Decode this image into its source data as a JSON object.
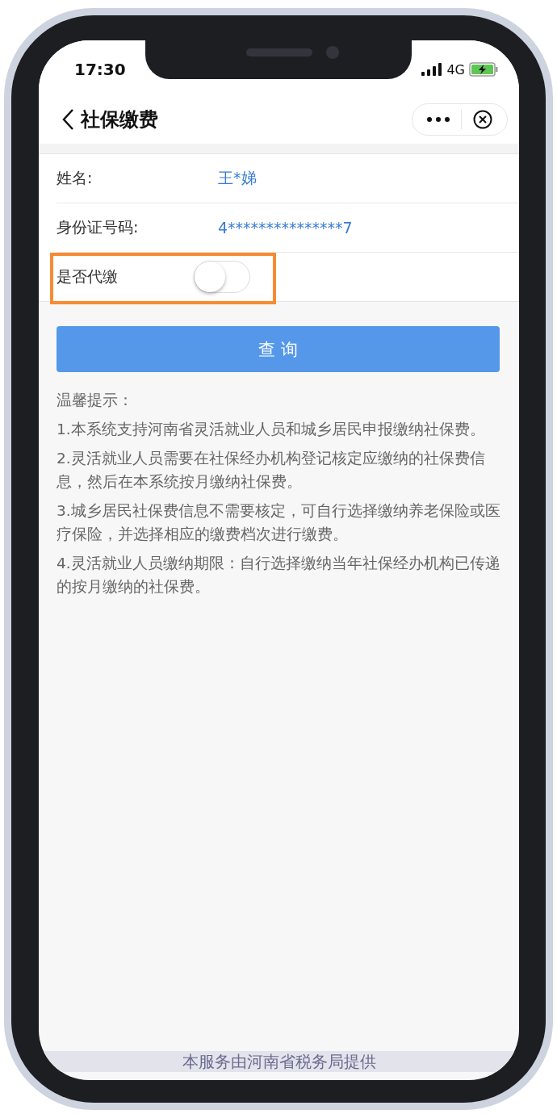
{
  "status_bar": {
    "time": "17:30",
    "network": "4G"
  },
  "nav": {
    "title": "社保缴费"
  },
  "form": {
    "rows": [
      {
        "kind": "text",
        "label": "姓名:",
        "value": "王*娣"
      },
      {
        "kind": "text",
        "label": "身份证号码:",
        "value": "4***************7"
      },
      {
        "kind": "toggle",
        "label": "是否代缴",
        "on": false,
        "highlighted": true
      }
    ]
  },
  "query_button": "查 询",
  "tips": {
    "title": "温馨提示：",
    "items": [
      "1.本系统支持河南省灵活就业人员和城乡居民申报缴纳社保费。",
      "2.灵活就业人员需要在社保经办机构登记核定应缴纳的社保费信息，然后在本系统按月缴纳社保费。",
      "3.城乡居民社保费信息不需要核定，可自行选择缴纳养老保险或医疗保险，并选择相应的缴费档次进行缴费。",
      "4.灵活就业人员缴纳期限：自行选择缴纳当年社保经办机构已传递的按月缴纳的社保费。"
    ]
  },
  "footer": "本服务由河南省税务局提供"
}
